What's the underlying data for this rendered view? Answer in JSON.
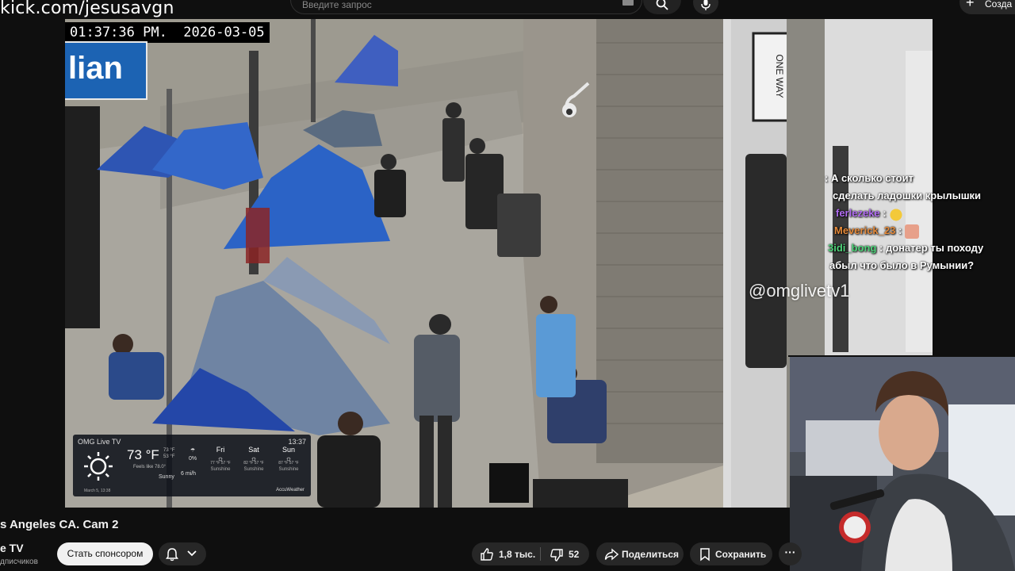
{
  "stream": {
    "url_overlay": "kick.com/jesusavgn"
  },
  "search": {
    "placeholder": "Введите запрос"
  },
  "header": {
    "create_label": "Созда"
  },
  "video": {
    "timestamp": "01:37:36 PM.  2026-03-05",
    "street_sign": "lian",
    "watermark": "@omglivetv1"
  },
  "chat": {
    "messages": [
      {
        "user": "",
        "text": ": А сколько стоит",
        "user_color": "#e05a5a",
        "text_color": "#ffffff"
      },
      {
        "user": "",
        "text": "сделать ладошки крылышки",
        "user_color": "#ffffff",
        "text_color": "#ffffff"
      },
      {
        "user": "ferlezeke",
        "text": " : ",
        "emote": "smug-emote",
        "user_color": "#b06cf0",
        "text_color": "#ffffff"
      },
      {
        "user": "Meverick_23",
        "text": " : ",
        "emote": "face-emote",
        "user_color": "#e58a3a",
        "text_color": "#ffffff"
      },
      {
        "user": "3idi_bong",
        "text": " : донатер ты походу",
        "user_color": "#4fd37a",
        "text_color": "#ffffff"
      },
      {
        "user": "",
        "text": "абыл что было в Румынии?",
        "user_color": "#ffffff",
        "text_color": "#ffffff"
      }
    ]
  },
  "weather": {
    "brand": "OMG Live TV",
    "time": "13:37",
    "current_temp": "73 °F",
    "hi_lo": [
      "73 °F",
      "53 °F"
    ],
    "feels_like": "Feels like 78.0°",
    "condition": "Sunny",
    "precip": "0%",
    "wind": "6 mi/h",
    "date": "March 5, 13:38",
    "provider": "AccuWeather",
    "forecast": [
      {
        "day": "Fri",
        "hi": "77 °F",
        "lo": "57 °F",
        "cond": "Sunshine"
      },
      {
        "day": "Sat",
        "hi": "82 °F",
        "lo": "57 °F",
        "cond": "Sunshine"
      },
      {
        "day": "Sun",
        "hi": "87 °F",
        "lo": "57 °F",
        "cond": "Sunshine"
      }
    ]
  },
  "below": {
    "title": "s Angeles CA. Cam 2",
    "channel": "e TV",
    "subscribers": "дписчиков",
    "sponsor_label": "Стать спонсором",
    "likes": "1,8 тыс.",
    "dislikes": "52",
    "share_label": "Поделиться",
    "save_label": "Сохранить",
    "more_label": "···"
  },
  "colors": {
    "background": "#0f0f0f",
    "pill": "#272727",
    "sponsor": "#f1f1f1",
    "sign_blue": "#1c63b3"
  }
}
